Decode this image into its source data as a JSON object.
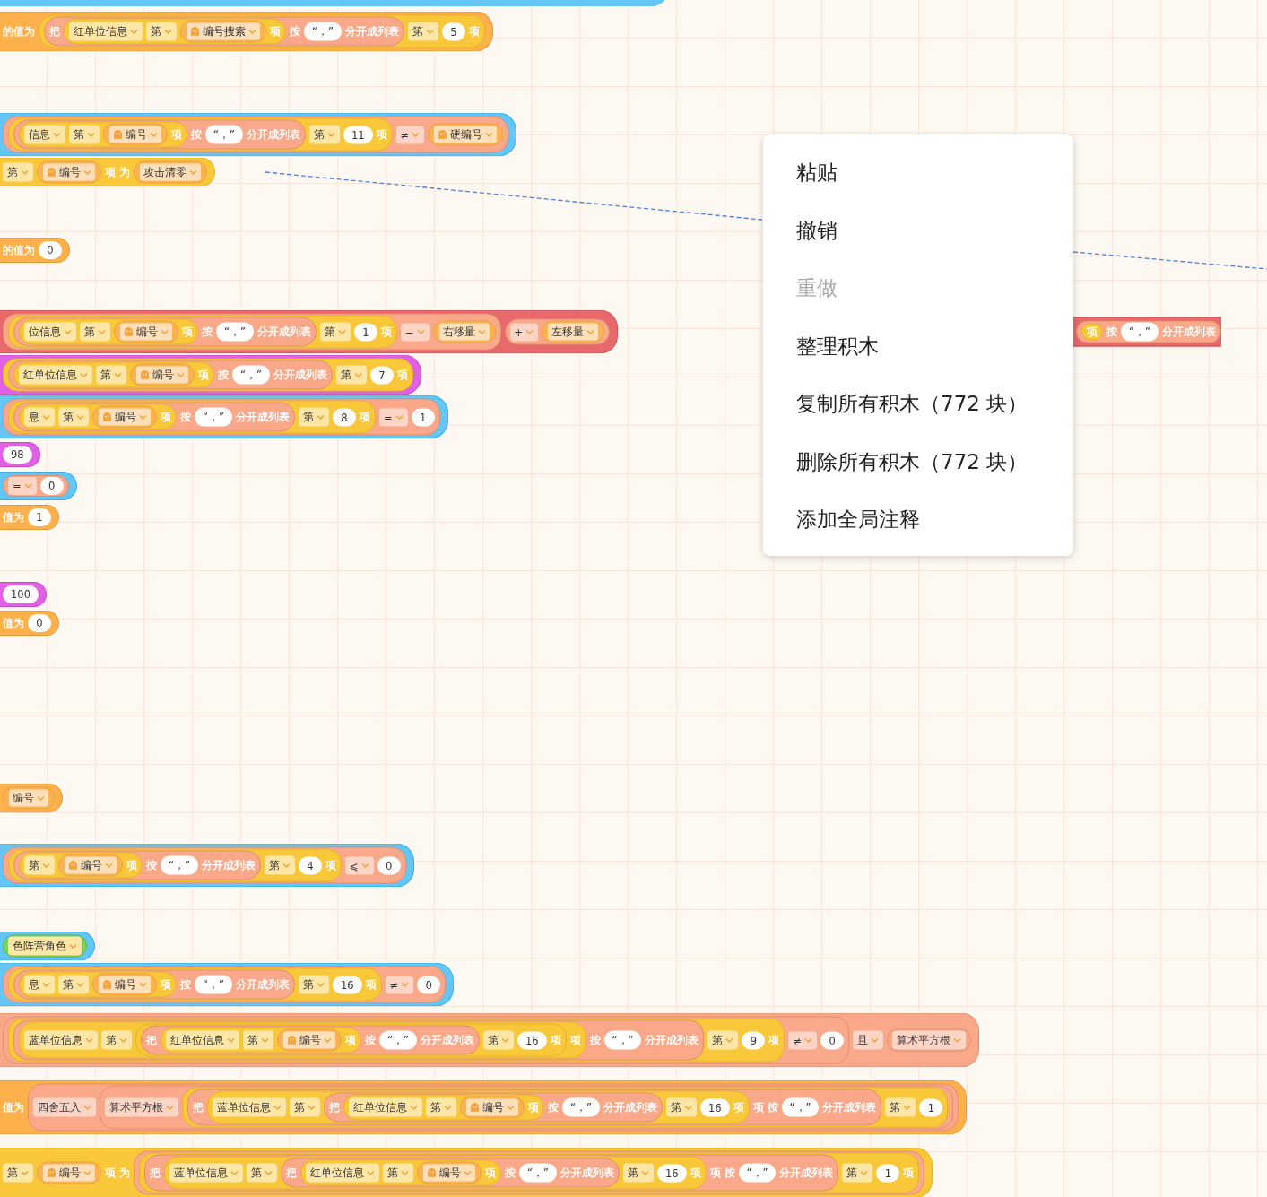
{
  "blocks": [
    {
      "kind": "datablock",
      "items": [
        {
          "kind": "label",
          "text": "的值为"
        },
        {
          "kind": "listblock",
          "items": [
            {
              "kind": "stringblock",
              "items": [
                {
                  "kind": "label",
                  "text": "把"
                },
                {
                  "kind": "listblock",
                  "items": [
                    {
                      "kind": "dropdown",
                      "text": "红单位信息"
                    },
                    {
                      "kind": "dropdown",
                      "text": "第"
                    },
                    {
                      "kind": "var",
                      "icon": true,
                      "text": "编号搜索"
                    },
                    {
                      "kind": "label",
                      "text": "项"
                    }
                  ]
                },
                {
                  "kind": "label",
                  "text": "按"
                },
                {
                  "kind": "textfield",
                  "text": "“，”"
                },
                {
                  "kind": "label",
                  "text": "分开成列表"
                }
              ]
            },
            {
              "kind": "dropdown",
              "text": "第"
            },
            {
              "kind": "numfield",
              "text": "5"
            },
            {
              "kind": "label",
              "text": "项"
            }
          ]
        }
      ]
    },
    {
      "kind": "logicblock",
      "items": [
        {
          "kind": "stringblock",
          "items": [
            {
              "kind": "listblock",
              "items": [
                {
                  "kind": "stringblock",
                  "items": [
                    {
                      "kind": "listblock",
                      "items": [
                        {
                          "kind": "dropdown",
                          "text": "信息"
                        },
                        {
                          "kind": "dropdown",
                          "text": "第"
                        },
                        {
                          "kind": "var",
                          "icon": true,
                          "text": "编号"
                        },
                        {
                          "kind": "label",
                          "text": "项"
                        }
                      ]
                    },
                    {
                      "kind": "label",
                      "text": "按"
                    },
                    {
                      "kind": "textfield",
                      "text": "“，”"
                    },
                    {
                      "kind": "label",
                      "text": "分开成列表"
                    }
                  ]
                },
                {
                  "kind": "dropdown",
                  "text": "第"
                },
                {
                  "kind": "numfield",
                  "text": "11"
                },
                {
                  "kind": "label",
                  "text": "项"
                }
              ]
            },
            {
              "kind": "operator",
              "text": "≠"
            },
            {
              "kind": "var",
              "icon": true,
              "text": "硬编号"
            }
          ]
        }
      ]
    },
    {
      "kind": "listblock",
      "items": [
        {
          "kind": "dropdown",
          "text": "第"
        },
        {
          "kind": "var",
          "icon": true,
          "text": "编号"
        },
        {
          "kind": "label",
          "text": "项"
        },
        {
          "kind": "label",
          "text": "为"
        },
        {
          "kind": "var",
          "icon": false,
          "text": "攻击清零"
        }
      ]
    },
    {
      "kind": "datablock",
      "items": [
        {
          "kind": "label",
          "text": "的值为"
        },
        {
          "kind": "numfield",
          "text": "0"
        }
      ]
    },
    {
      "kind": "controlblock",
      "items": [
        {
          "kind": "stringblock",
          "items": [
            {
              "kind": "listblock",
              "items": [
                {
                  "kind": "stringblock",
                  "items": [
                    {
                      "kind": "listblock",
                      "items": [
                        {
                          "kind": "dropdown",
                          "text": "位信息"
                        },
                        {
                          "kind": "dropdown",
                          "text": "第"
                        },
                        {
                          "kind": "var",
                          "icon": true,
                          "text": "编号"
                        },
                        {
                          "kind": "label",
                          "text": "项"
                        }
                      ]
                    },
                    {
                      "kind": "label",
                      "text": "按"
                    },
                    {
                      "kind": "textfield",
                      "text": "“，”"
                    },
                    {
                      "kind": "label",
                      "text": "分开成列表"
                    }
                  ]
                },
                {
                  "kind": "dropdown",
                  "text": "第"
                },
                {
                  "kind": "numfield",
                  "text": "1"
                },
                {
                  "kind": "label",
                  "text": "项"
                }
              ]
            },
            {
              "kind": "operator",
              "text": "−"
            },
            {
              "kind": "var",
              "icon": false,
              "text": "右移量"
            }
          ]
        },
        {
          "kind": "stringblock",
          "items": [
            {
              "kind": "operator",
              "text": "+"
            },
            {
              "kind": "var",
              "icon": false,
              "text": "左移量"
            }
          ]
        }
      ]
    },
    {
      "kind": "controlblock",
      "items": [
        {
          "kind": "stringblock",
          "items": [
            {
              "kind": "listblock",
              "items": [
                {
                  "kind": "label",
                  "text": "项"
                }
              ]
            },
            {
              "kind": "label",
              "text": "按"
            },
            {
              "kind": "textfield",
              "text": "“，”"
            },
            {
              "kind": "label",
              "text": "分开成列表"
            }
          ]
        }
      ]
    },
    {
      "kind": "mathblock",
      "items": [
        {
          "kind": "listblock",
          "items": [
            {
              "kind": "stringblock",
              "items": [
                {
                  "kind": "listblock",
                  "items": [
                    {
                      "kind": "dropdown",
                      "text": "红单位信息"
                    },
                    {
                      "kind": "dropdown",
                      "text": "第"
                    },
                    {
                      "kind": "var",
                      "icon": true,
                      "text": "编号"
                    },
                    {
                      "kind": "label",
                      "text": "项"
                    }
                  ]
                },
                {
                  "kind": "label",
                  "text": "按"
                },
                {
                  "kind": "textfield",
                  "text": "“，”"
                },
                {
                  "kind": "label",
                  "text": "分开成列表"
                }
              ]
            },
            {
              "kind": "dropdown",
              "text": "第"
            },
            {
              "kind": "numfield",
              "text": "7"
            },
            {
              "kind": "label",
              "text": "项"
            }
          ]
        }
      ]
    },
    {
      "kind": "logicblock",
      "items": [
        {
          "kind": "stringblock",
          "items": [
            {
              "kind": "listblock",
              "items": [
                {
                  "kind": "stringblock",
                  "items": [
                    {
                      "kind": "listblock",
                      "items": [
                        {
                          "kind": "dropdown",
                          "text": "息"
                        },
                        {
                          "kind": "dropdown",
                          "text": "第"
                        },
                        {
                          "kind": "var",
                          "icon": true,
                          "text": "编号"
                        },
                        {
                          "kind": "label",
                          "text": "项"
                        }
                      ]
                    },
                    {
                      "kind": "label",
                      "text": "按"
                    },
                    {
                      "kind": "textfield",
                      "text": "“，”"
                    },
                    {
                      "kind": "label",
                      "text": "分开成列表"
                    }
                  ]
                },
                {
                  "kind": "dropdown",
                  "text": "第"
                },
                {
                  "kind": "numfield",
                  "text": "8"
                },
                {
                  "kind": "label",
                  "text": "项"
                }
              ]
            },
            {
              "kind": "operator",
              "text": "="
            },
            {
              "kind": "numfield",
              "text": "1"
            }
          ]
        }
      ]
    },
    {
      "kind": "mathblock",
      "items": [
        {
          "kind": "numfield",
          "text": "98"
        }
      ]
    },
    {
      "kind": "logicblock",
      "items": [
        {
          "kind": "stringblock",
          "items": [
            {
              "kind": "operator",
              "text": "="
            },
            {
              "kind": "numfield",
              "text": "0"
            }
          ]
        }
      ]
    },
    {
      "kind": "datablock",
      "items": [
        {
          "kind": "label",
          "text": "值为"
        },
        {
          "kind": "numfield",
          "text": "1"
        }
      ]
    },
    {
      "kind": "mathblock",
      "items": [
        {
          "kind": "numfield",
          "text": "100"
        }
      ]
    },
    {
      "kind": "datablock",
      "items": [
        {
          "kind": "label",
          "text": "值为"
        },
        {
          "kind": "numfield",
          "text": "0"
        }
      ]
    },
    {
      "kind": "datablock",
      "items": [
        {
          "kind": "var",
          "icon": false,
          "text": "编号"
        }
      ]
    },
    {
      "kind": "logicblock",
      "items": [
        {
          "kind": "stringblock",
          "items": [
            {
              "kind": "listblock",
              "items": [
                {
                  "kind": "stringblock",
                  "items": [
                    {
                      "kind": "listblock",
                      "items": [
                        {
                          "kind": "dropdown",
                          "text": "第"
                        },
                        {
                          "kind": "var",
                          "icon": true,
                          "text": "编号"
                        },
                        {
                          "kind": "label",
                          "text": "项"
                        }
                      ]
                    },
                    {
                      "kind": "label",
                      "text": "按"
                    },
                    {
                      "kind": "textfield",
                      "text": "“，”"
                    },
                    {
                      "kind": "label",
                      "text": "分开成列表"
                    }
                  ]
                },
                {
                  "kind": "dropdown",
                  "text": "第"
                },
                {
                  "kind": "numfield",
                  "text": "4"
                },
                {
                  "kind": "label",
                  "text": "项"
                }
              ]
            },
            {
              "kind": "operator",
              "text": "⩽"
            },
            {
              "kind": "numfield",
              "text": "0"
            }
          ]
        }
      ]
    },
    {
      "kind": "logicblock",
      "items": [
        {
          "kind": "eventblock",
          "items": [
            {
              "kind": "dropdown",
              "text": "色阵营角色"
            }
          ]
        }
      ]
    },
    {
      "kind": "logicblock",
      "items": [
        {
          "kind": "stringblock",
          "items": [
            {
              "kind": "listblock",
              "items": [
                {
                  "kind": "stringblock",
                  "items": [
                    {
                      "kind": "listblock",
                      "items": [
                        {
                          "kind": "dropdown",
                          "text": "息"
                        },
                        {
                          "kind": "dropdown",
                          "text": "第"
                        },
                        {
                          "kind": "var",
                          "icon": true,
                          "text": "编号"
                        },
                        {
                          "kind": "label",
                          "text": "项"
                        }
                      ]
                    },
                    {
                      "kind": "label",
                      "text": "按"
                    },
                    {
                      "kind": "textfield",
                      "text": "“，”"
                    },
                    {
                      "kind": "label",
                      "text": "分开成列表"
                    }
                  ]
                },
                {
                  "kind": "dropdown",
                  "text": "第"
                },
                {
                  "kind": "numfield",
                  "text": "16"
                },
                {
                  "kind": "label",
                  "text": "项"
                }
              ]
            },
            {
              "kind": "operator",
              "text": "≠"
            },
            {
              "kind": "numfield",
              "text": "0"
            }
          ]
        }
      ]
    },
    {
      "kind": "stringblock",
      "items": [
        {
          "kind": "stringblock",
          "items": [
            {
              "kind": "listblock",
              "items": [
                {
                  "kind": "stringblock",
                  "items": [
                    {
                      "kind": "listblock",
                      "items": [
                        {
                          "kind": "dropdown",
                          "text": "蓝单位信息"
                        },
                        {
                          "kind": "dropdown",
                          "text": "第"
                        },
                        {
                          "kind": "listblock",
                          "items": [
                            {
                              "kind": "stringblock",
                              "items": [
                                {
                                  "kind": "label",
                                  "text": "把"
                                },
                                {
                                  "kind": "listblock",
                                  "items": [
                                    {
                                      "kind": "dropdown",
                                      "text": "红单位信息"
                                    },
                                    {
                                      "kind": "dropdown",
                                      "text": "第"
                                    },
                                    {
                                      "kind": "var",
                                      "icon": true,
                                      "text": "编号"
                                    },
                                    {
                                      "kind": "label",
                                      "text": "项"
                                    }
                                  ]
                                },
                                {
                                  "kind": "label",
                                  "text": "按"
                                },
                                {
                                  "kind": "textfield",
                                  "text": "“，”"
                                },
                                {
                                  "kind": "label",
                                  "text": "分开成列表"
                                }
                              ]
                            },
                            {
                              "kind": "dropdown",
                              "text": "第"
                            },
                            {
                              "kind": "numfield",
                              "text": "16"
                            },
                            {
                              "kind": "label",
                              "text": "项"
                            }
                          ]
                        },
                        {
                          "kind": "label",
                          "text": "项"
                        }
                      ]
                    },
                    {
                      "kind": "label",
                      "text": "按"
                    },
                    {
                      "kind": "textfield",
                      "text": "“，”"
                    },
                    {
                      "kind": "label",
                      "text": "分开成列表"
                    }
                  ]
                },
                {
                  "kind": "dropdown",
                  "text": "第"
                },
                {
                  "kind": "numfield",
                  "text": "9"
                },
                {
                  "kind": "label",
                  "text": "项"
                }
              ]
            },
            {
              "kind": "operator",
              "text": "≠"
            },
            {
              "kind": "numfield",
              "text": "0"
            }
          ]
        },
        {
          "kind": "operator",
          "text": "且"
        },
        {
          "kind": "stringblock",
          "items": [
            {
              "kind": "operator",
              "text": "算术平方根"
            }
          ]
        }
      ]
    },
    {
      "kind": "datablock",
      "items": [
        {
          "kind": "label",
          "text": "值为"
        },
        {
          "kind": "stringblock",
          "items": [
            {
              "kind": "operator",
              "text": "四舍五入"
            },
            {
              "kind": "stringblock",
              "items": [
                {
                  "kind": "operator",
                  "text": "算术平方根"
                },
                {
                  "kind": "listblock",
                  "items": [
                    {
                      "kind": "stringblock",
                      "items": [
                        {
                          "kind": "label",
                          "text": "把"
                        },
                        {
                          "kind": "listblock",
                          "items": [
                            {
                              "kind": "dropdown",
                              "text": "蓝单位信息"
                            },
                            {
                              "kind": "dropdown",
                              "text": "第"
                            },
                            {
                              "kind": "stringblock",
                              "items": [
                                {
                                  "kind": "label",
                                  "text": "把"
                                },
                                {
                                  "kind": "listblock",
                                  "items": [
                                    {
                                      "kind": "dropdown",
                                      "text": "红单位信息"
                                    },
                                    {
                                      "kind": "dropdown",
                                      "text": "第"
                                    },
                                    {
                                      "kind": "var",
                                      "icon": true,
                                      "text": "编号"
                                    },
                                    {
                                      "kind": "label",
                                      "text": "项"
                                    }
                                  ]
                                },
                                {
                                  "kind": "label",
                                  "text": "按"
                                },
                                {
                                  "kind": "textfield",
                                  "text": "“，”"
                                },
                                {
                                  "kind": "label",
                                  "text": "分开成列表"
                                }
                              ]
                            },
                            {
                              "kind": "dropdown",
                              "text": "第"
                            },
                            {
                              "kind": "numfield",
                              "text": "16"
                            },
                            {
                              "kind": "label",
                              "text": "项"
                            }
                          ]
                        },
                        {
                          "kind": "label",
                          "text": "项"
                        },
                        {
                          "kind": "label",
                          "text": "按"
                        },
                        {
                          "kind": "textfield",
                          "text": "“，”"
                        },
                        {
                          "kind": "label",
                          "text": "分开成列表"
                        }
                      ]
                    },
                    {
                      "kind": "dropdown",
                      "text": "第"
                    },
                    {
                      "kind": "numfield",
                      "text": "1"
                    }
                  ]
                }
              ]
            }
          ]
        }
      ]
    },
    {
      "kind": "listblock",
      "items": [
        {
          "kind": "dropdown",
          "text": "第"
        },
        {
          "kind": "var",
          "icon": true,
          "text": "编号"
        },
        {
          "kind": "label",
          "text": "项"
        },
        {
          "kind": "label",
          "text": "为"
        },
        {
          "kind": "stringblock",
          "items": [
            {
              "kind": "listblock",
              "items": [
                {
                  "kind": "stringblock",
                  "items": [
                    {
                      "kind": "label",
                      "text": "把"
                    },
                    {
                      "kind": "listblock",
                      "items": [
                        {
                          "kind": "dropdown",
                          "text": "蓝单位信息"
                        },
                        {
                          "kind": "dropdown",
                          "text": "第"
                        },
                        {
                          "kind": "stringblock",
                          "items": [
                            {
                              "kind": "label",
                              "text": "把"
                            },
                            {
                              "kind": "listblock",
                              "items": [
                                {
                                  "kind": "dropdown",
                                  "text": "红单位信息"
                                },
                                {
                                  "kind": "dropdown",
                                  "text": "第"
                                },
                                {
                                  "kind": "var",
                                  "icon": true,
                                  "text": "编号"
                                },
                                {
                                  "kind": "label",
                                  "text": "项"
                                }
                              ]
                            },
                            {
                              "kind": "label",
                              "text": "按"
                            },
                            {
                              "kind": "textfield",
                              "text": "“，”"
                            },
                            {
                              "kind": "label",
                              "text": "分开成列表"
                            }
                          ]
                        },
                        {
                          "kind": "dropdown",
                          "text": "第"
                        },
                        {
                          "kind": "numfield",
                          "text": "16"
                        },
                        {
                          "kind": "label",
                          "text": "项"
                        }
                      ]
                    },
                    {
                      "kind": "label",
                      "text": "项"
                    },
                    {
                      "kind": "label",
                      "text": "按"
                    },
                    {
                      "kind": "textfield",
                      "text": "“，”"
                    },
                    {
                      "kind": "label",
                      "text": "分开成列表"
                    }
                  ]
                },
                {
                  "kind": "dropdown",
                  "text": "第"
                },
                {
                  "kind": "numfield",
                  "text": "1"
                },
                {
                  "kind": "label",
                  "text": "项"
                }
              ]
            }
          ]
        }
      ]
    }
  ],
  "context_menu": {
    "items": [
      {
        "label": "粘贴",
        "disabled": false
      },
      {
        "label": "撤销",
        "disabled": false
      },
      {
        "label": "重做",
        "disabled": true
      },
      {
        "label": "整理积木",
        "disabled": false
      },
      {
        "label": "复制所有积木（772 块）",
        "disabled": false
      },
      {
        "label": "删除所有积木（772 块）",
        "disabled": false
      },
      {
        "label": "添加全局注释",
        "disabled": false
      }
    ]
  }
}
